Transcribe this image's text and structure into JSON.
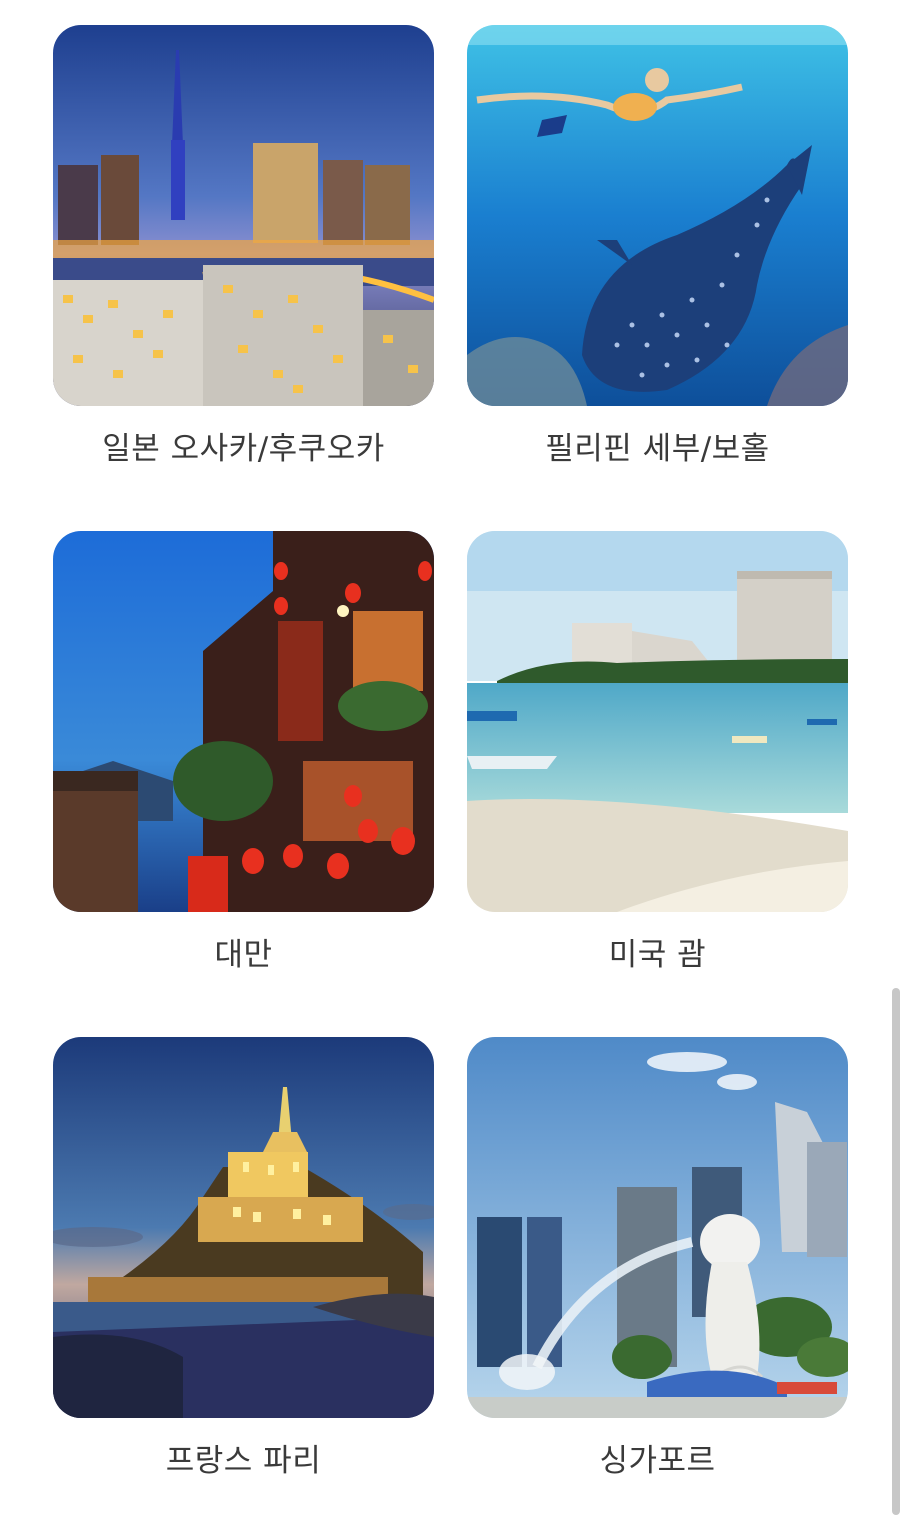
{
  "destinations": [
    {
      "label": "일본 오사카/후쿠오카",
      "image": "night-city-skyline-tower"
    },
    {
      "label": "필리핀 세부/보홀",
      "image": "snorkeler-whale-shark"
    },
    {
      "label": "대만",
      "image": "lantern-lit-old-street"
    },
    {
      "label": "미국 괌",
      "image": "tropical-beach-resort-hotels"
    },
    {
      "label": "프랑스 파리",
      "image": "illuminated-island-abbey"
    },
    {
      "label": "싱가포르",
      "image": "merlion-fountain-skyline"
    }
  ],
  "colors": {
    "label_text": "#3a3a3a",
    "background": "#ffffff",
    "scrollbar": "#c7c7c7"
  }
}
